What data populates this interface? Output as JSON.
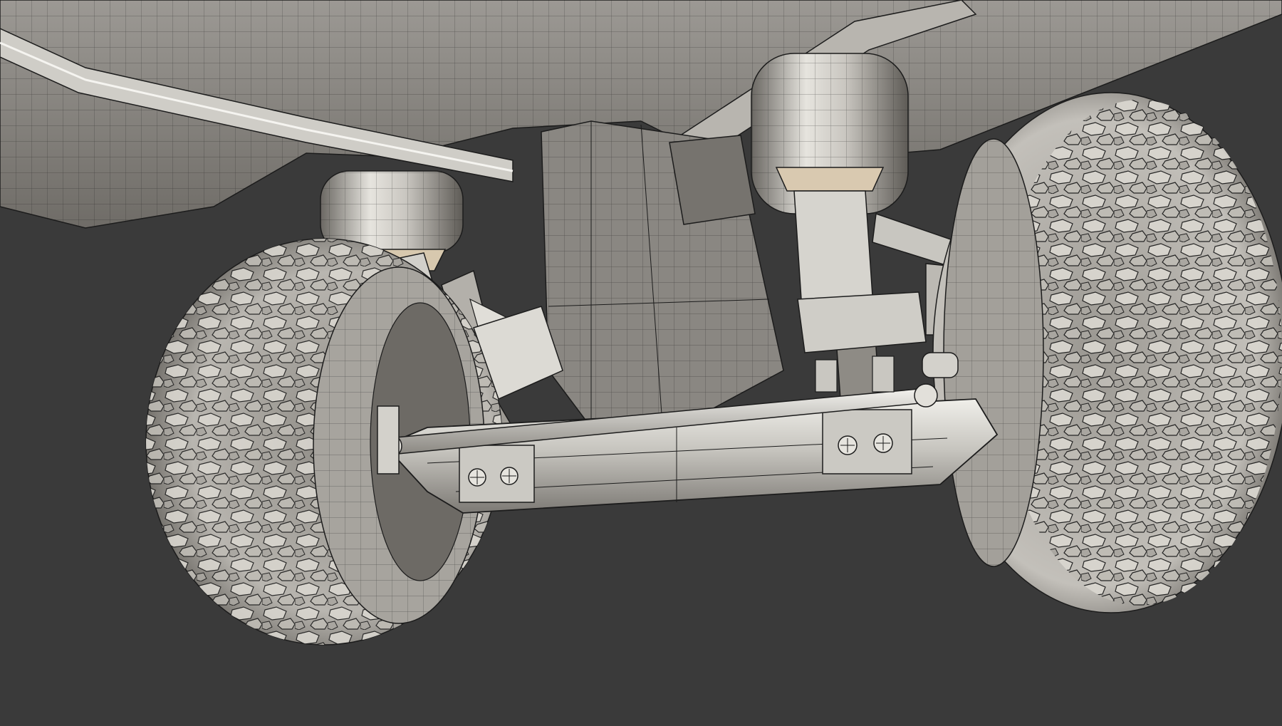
{
  "viewport": {
    "background_color": "#3a3a3a",
    "wire_color": "#1c1c1c",
    "metal_light": "#e8e6e0",
    "metal_mid": "#a9a6a0",
    "metal_dark": "#55524d",
    "warm_highlight": "#d9c9b0"
  },
  "scene": {
    "objects": [
      "chassis-underbody",
      "left-air-spring",
      "right-air-spring",
      "left-tire",
      "right-tire",
      "axle-beam",
      "tie-rod",
      "differential-housing",
      "shock-absorbers",
      "mounting-bolts"
    ]
  }
}
